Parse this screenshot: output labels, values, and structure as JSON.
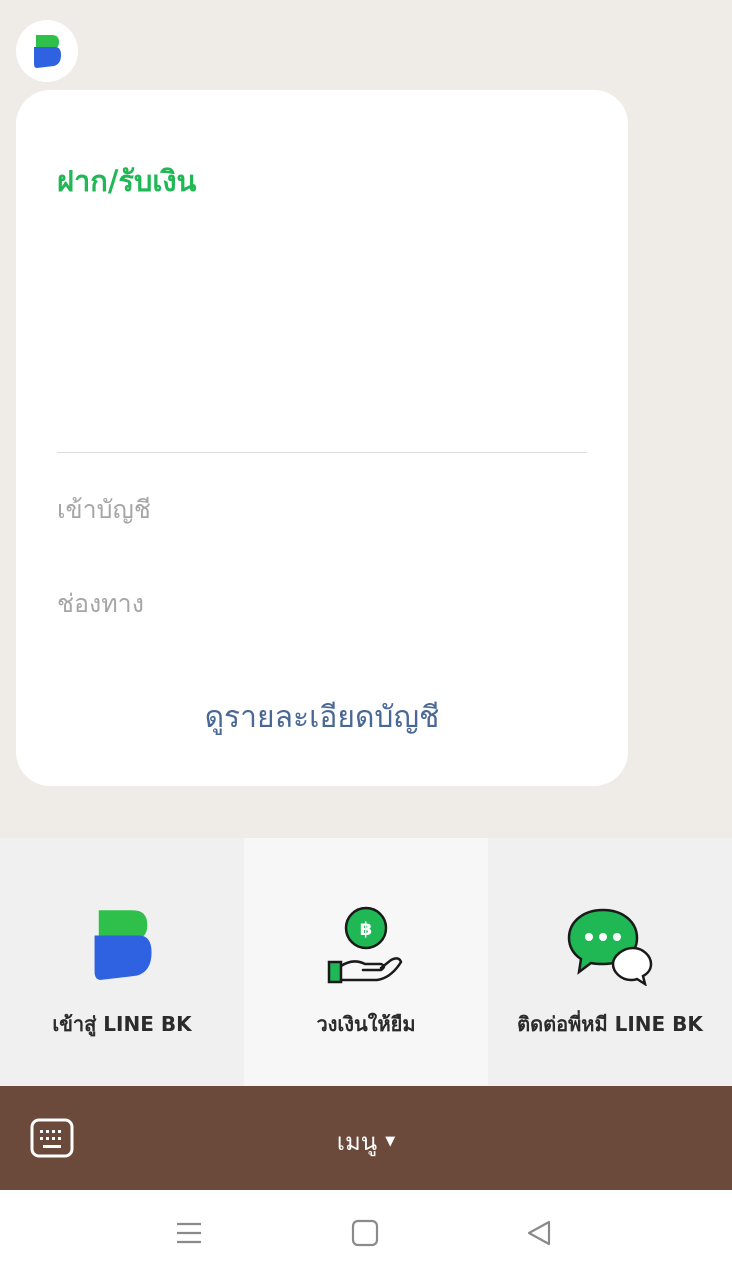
{
  "chat": {
    "card": {
      "title": "ฝาก/รับเงิน",
      "labels": [
        "เข้าบัญชี",
        "ช่องทาง"
      ],
      "view_details": "ดูรายละเอียดบัญชี"
    }
  },
  "rich_menu": {
    "items": [
      {
        "label": "เข้าสู่ LINE BK",
        "icon": "line-bk-logo-icon"
      },
      {
        "label": "วงเงินให้ยืม",
        "icon": "hand-coin-icon"
      },
      {
        "label": "ติดต่อพี่หมี LINE BK",
        "icon": "chat-bubbles-icon"
      }
    ]
  },
  "menu_bar": {
    "label": "เมนู"
  },
  "colors": {
    "accent_green": "#1fb855",
    "link_blue": "#4a6895",
    "menu_bar": "#6b4a3c",
    "chat_bg": "#efebe6"
  }
}
